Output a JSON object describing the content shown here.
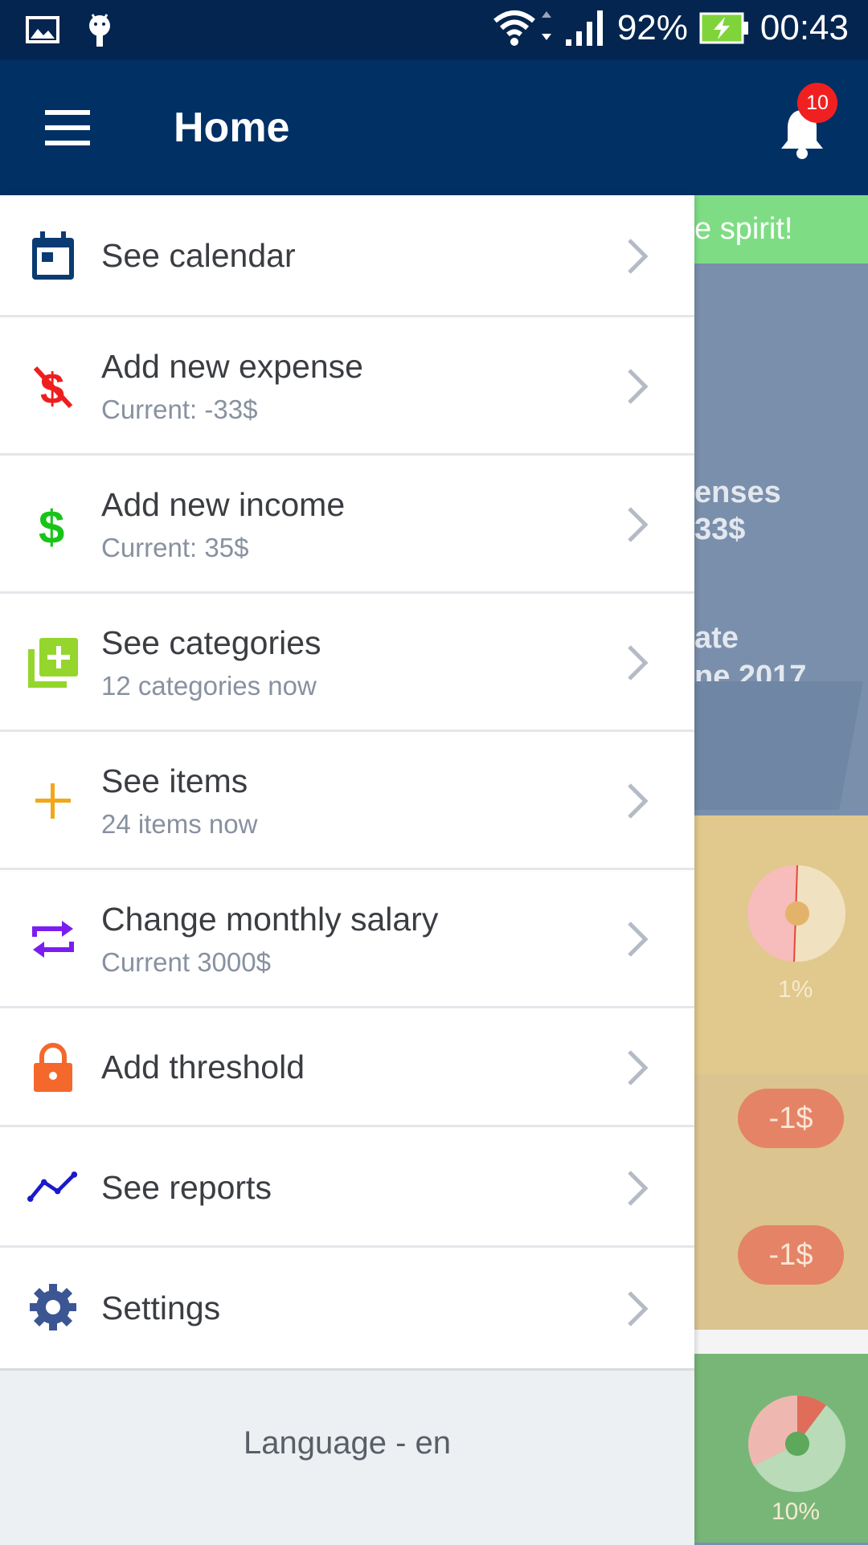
{
  "status_bar": {
    "battery": "92%",
    "time": "00:43"
  },
  "app_bar": {
    "title": "Home",
    "notification_count": "10"
  },
  "background": {
    "banner_text": "e spirit!",
    "summary_line1": "enses",
    "summary_line2": "33$",
    "date_line1": "ate",
    "date_line2": "ne 2017",
    "pie1_pct": "1%",
    "pill1": "-1$",
    "pill2": "-1$",
    "pie2_pct": "10%"
  },
  "drawer": {
    "items": [
      {
        "label": "See calendar",
        "sub": "",
        "icon": "calendar-icon",
        "color": "#0a3b72"
      },
      {
        "label": "Add new expense",
        "sub": "Current: -33$",
        "icon": "money-off-icon",
        "color": "#ef1e1e"
      },
      {
        "label": "Add new income",
        "sub": "Current: 35$",
        "icon": "dollar-icon",
        "color": "#18c418"
      },
      {
        "label": "See categories",
        "sub": "12 categories now",
        "icon": "add-library-icon",
        "color": "#94d62c"
      },
      {
        "label": "See items",
        "sub": "24 items now",
        "icon": "plus-icon",
        "color": "#f0a81a"
      },
      {
        "label": "Change monthly salary",
        "sub": "Current 3000$",
        "icon": "repeat-icon",
        "color": "#7a1ef0"
      },
      {
        "label": "Add threshold",
        "sub": "",
        "icon": "lock-icon",
        "color": "#f4682c"
      },
      {
        "label": "See reports",
        "sub": "",
        "icon": "trending-icon",
        "color": "#1a1acb"
      },
      {
        "label": "Settings",
        "sub": "",
        "icon": "gear-icon",
        "color": "#3c5693"
      }
    ],
    "footer_text": "Language - en"
  }
}
